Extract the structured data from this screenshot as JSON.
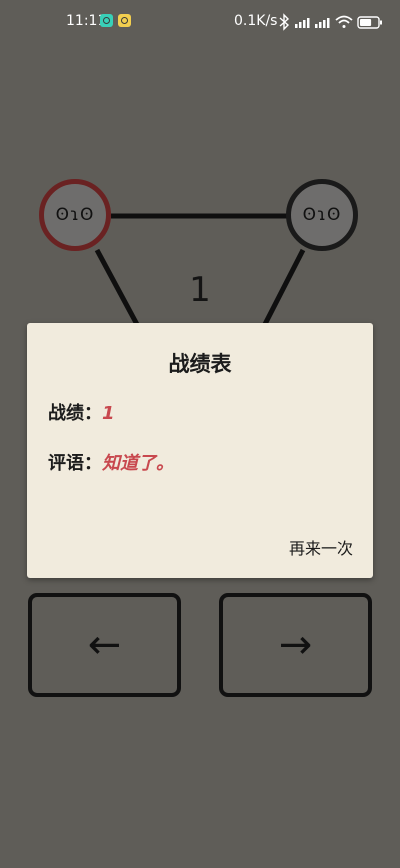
{
  "status_bar": {
    "time": "11:11",
    "speed": "0.1K/s",
    "icons": [
      "app-badge-icon",
      "app-badge-icon",
      "bluetooth-icon",
      "signal-icon",
      "signal-icon",
      "wifi-icon",
      "battery-icon"
    ],
    "battery_level": 0.65
  },
  "board": {
    "nodes": [
      {
        "face": "ʘɿʘ",
        "state": "active",
        "ring_color": "#6a2222"
      },
      {
        "face": "ʘɿʘ",
        "state": "inactive",
        "ring_color": "#1a1a1a"
      }
    ],
    "score": "1"
  },
  "dialog": {
    "title": "战绩表",
    "record_label": "战绩：",
    "record_value": "1",
    "comment_label": "评语：",
    "comment_value": "知道了。",
    "retry_label": "再来一次"
  },
  "controls": {
    "left_arrow": "←",
    "right_arrow": "→"
  },
  "colors": {
    "background": "#5f5d58",
    "dialog_bg": "#f1ebdd",
    "accent_red": "#c8484e",
    "active_ring": "#6a2222"
  }
}
